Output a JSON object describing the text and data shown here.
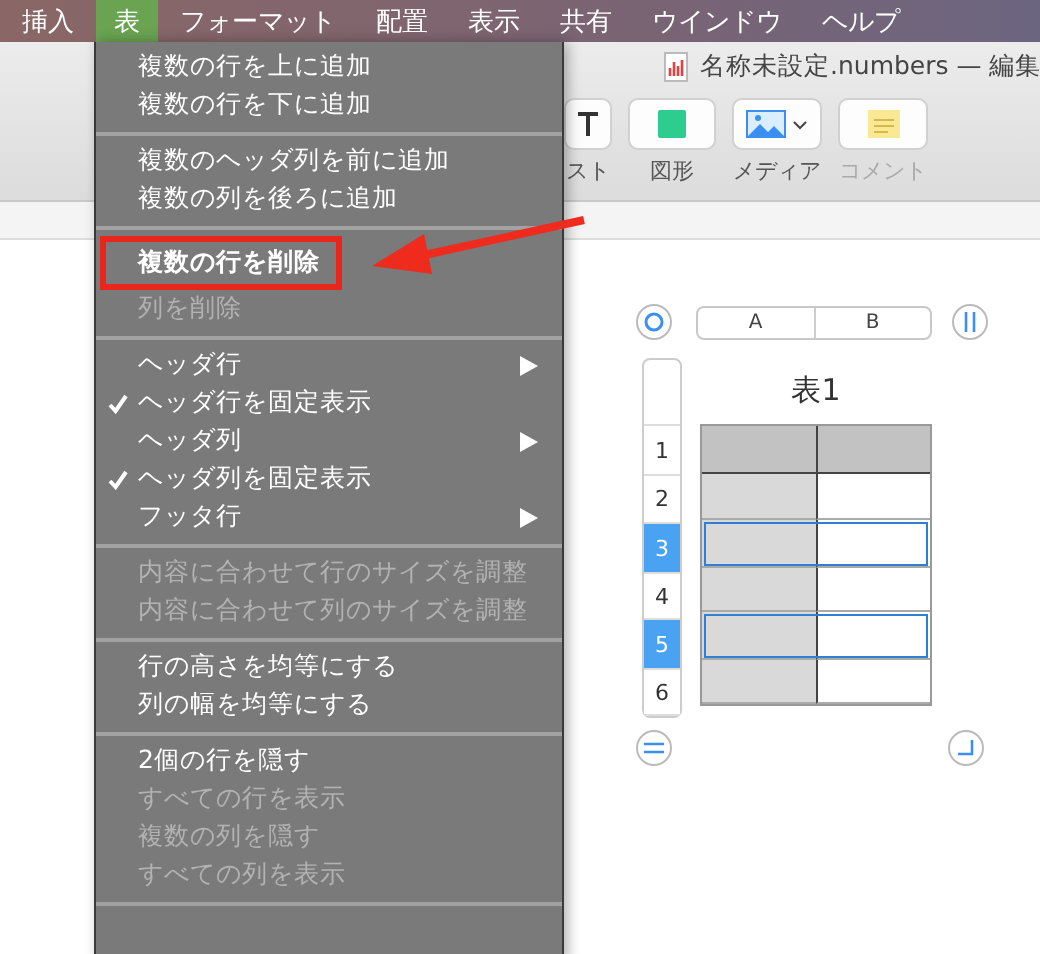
{
  "menubar": [
    {
      "label": "挿入",
      "selected": false
    },
    {
      "label": "表",
      "selected": true
    },
    {
      "label": "フォーマット",
      "selected": false
    },
    {
      "label": "配置",
      "selected": false
    },
    {
      "label": "表示",
      "selected": false
    },
    {
      "label": "共有",
      "selected": false
    },
    {
      "label": "ウインドウ",
      "selected": false
    },
    {
      "label": "ヘルプ",
      "selected": false
    }
  ],
  "window": {
    "title": "名称未設定.numbers — 編集"
  },
  "toolbar": [
    {
      "label": "スト",
      "kind": "text",
      "disabled": false
    },
    {
      "label": "図形",
      "kind": "shape",
      "disabled": false
    },
    {
      "label": "メディア",
      "kind": "media",
      "disabled": false
    },
    {
      "label": "コメント",
      "kind": "comment",
      "disabled": true
    }
  ],
  "menu": {
    "groups": [
      [
        {
          "label": "複数の行を上に追加",
          "disabled": false,
          "checked": false,
          "submenu": false,
          "annotated": false
        },
        {
          "label": "複数の行を下に追加",
          "disabled": false,
          "checked": false,
          "submenu": false,
          "annotated": false
        }
      ],
      [
        {
          "label": "複数のヘッダ列を前に追加",
          "disabled": false,
          "checked": false,
          "submenu": false,
          "annotated": false
        },
        {
          "label": "複数の列を後ろに追加",
          "disabled": false,
          "checked": false,
          "submenu": false,
          "annotated": false
        }
      ],
      [
        {
          "label": "複数の行を削除",
          "disabled": false,
          "checked": false,
          "submenu": false,
          "annotated": true
        },
        {
          "label": "列を削除",
          "disabled": true,
          "checked": false,
          "submenu": false,
          "annotated": false
        }
      ],
      [
        {
          "label": "ヘッダ行",
          "disabled": false,
          "checked": false,
          "submenu": true,
          "annotated": false
        },
        {
          "label": "ヘッダ行を固定表示",
          "disabled": false,
          "checked": true,
          "submenu": false,
          "annotated": false
        },
        {
          "label": "ヘッダ列",
          "disabled": false,
          "checked": false,
          "submenu": true,
          "annotated": false
        },
        {
          "label": "ヘッダ列を固定表示",
          "disabled": false,
          "checked": true,
          "submenu": false,
          "annotated": false
        },
        {
          "label": "フッタ行",
          "disabled": false,
          "checked": false,
          "submenu": true,
          "annotated": false
        }
      ],
      [
        {
          "label": "内容に合わせて行のサイズを調整",
          "disabled": true,
          "checked": false,
          "submenu": false,
          "annotated": false
        },
        {
          "label": "内容に合わせて列のサイズを調整",
          "disabled": true,
          "checked": false,
          "submenu": false,
          "annotated": false
        }
      ],
      [
        {
          "label": "行の高さを均等にする",
          "disabled": false,
          "checked": false,
          "submenu": false,
          "annotated": false
        },
        {
          "label": "列の幅を均等にする",
          "disabled": false,
          "checked": false,
          "submenu": false,
          "annotated": false
        }
      ],
      [
        {
          "label": "2個の行を隠す",
          "disabled": false,
          "checked": false,
          "submenu": false,
          "annotated": false
        },
        {
          "label": "すべての行を表示",
          "disabled": true,
          "checked": false,
          "submenu": false,
          "annotated": false
        },
        {
          "label": "複数の列を隠す",
          "disabled": true,
          "checked": false,
          "submenu": false,
          "annotated": false
        },
        {
          "label": "すべての列を表示",
          "disabled": true,
          "checked": false,
          "submenu": false,
          "annotated": false
        }
      ]
    ]
  },
  "sheet": {
    "title": "表1",
    "columns": [
      "A",
      "B"
    ],
    "rows": [
      {
        "label": "1",
        "selected": false
      },
      {
        "label": "2",
        "selected": false
      },
      {
        "label": "3",
        "selected": true
      },
      {
        "label": "4",
        "selected": false
      },
      {
        "label": "5",
        "selected": true
      },
      {
        "label": "6",
        "selected": false
      }
    ]
  }
}
